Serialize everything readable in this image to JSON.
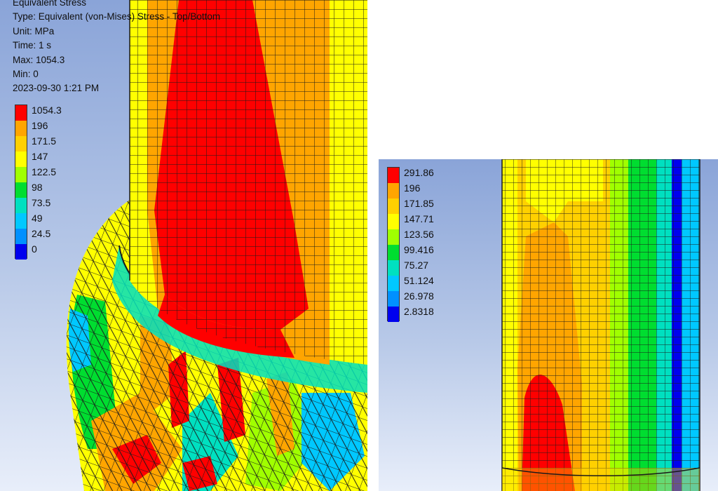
{
  "left_view": {
    "info": {
      "title": "Equivalent Stress",
      "type": "Type: Equivalent (von-Mises) Stress - Top/Bottom",
      "unit": "Unit: MPa",
      "time": "Time: 1 s",
      "max": "Max: 1054.3",
      "min": "Min: 0",
      "timestamp": "2023-09-30 1:21 PM"
    },
    "legend": {
      "labels": [
        "1054.3",
        "196",
        "171.5",
        "147",
        "122.5",
        "98",
        "73.5",
        "49",
        "24.5",
        "0"
      ],
      "colors": [
        "#ff0000",
        "#ffa500",
        "#ffd000",
        "#ffff00",
        "#a0ff00",
        "#00dd30",
        "#00e0c0",
        "#00c8ff",
        "#0090ff",
        "#0000ee"
      ]
    }
  },
  "right_view": {
    "legend": {
      "labels": [
        "291.86",
        "196",
        "171.85",
        "147.71",
        "123.56",
        "99.416",
        "75.27",
        "51.124",
        "26.978",
        "2.8318"
      ],
      "colors": [
        "#ff0000",
        "#ffa500",
        "#ffd000",
        "#ffff00",
        "#a0ff00",
        "#00dd30",
        "#00e0c0",
        "#00c8ff",
        "#0090ff",
        "#0000ee"
      ]
    }
  },
  "colors": {
    "background_top": "#8aa4d8",
    "background_bottom": "#e8eefa",
    "mesh_line": "#1a1a1a"
  }
}
